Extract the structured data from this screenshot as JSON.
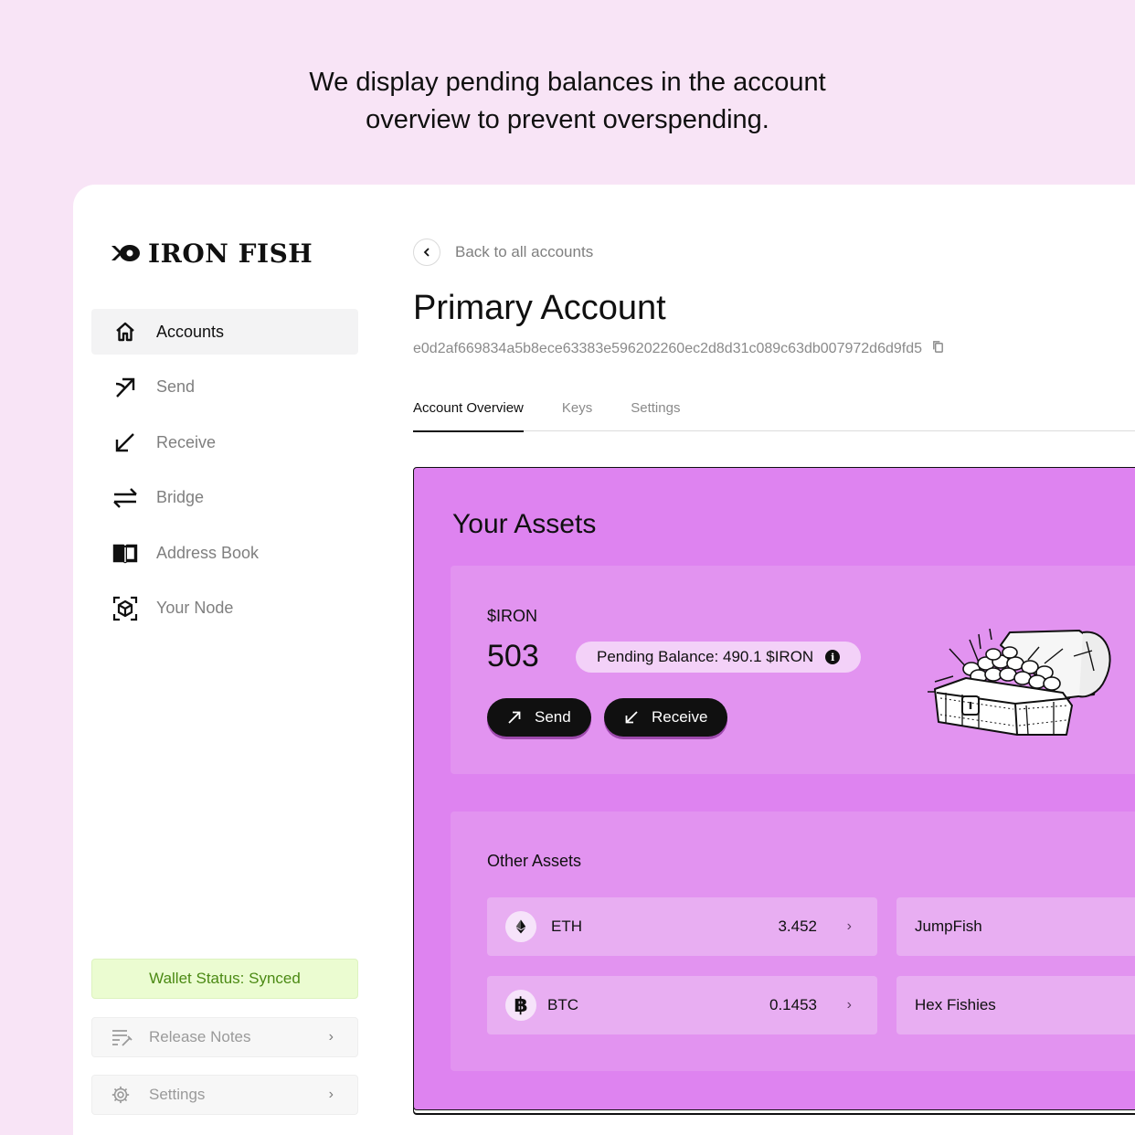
{
  "caption": {
    "line1": "We display pending balances in the account",
    "line2": "overview to prevent overspending."
  },
  "brand": {
    "name": "IRON FISH"
  },
  "sidebar": {
    "items": [
      {
        "label": "Accounts",
        "icon": "home-icon",
        "active": true
      },
      {
        "label": "Send",
        "icon": "send-arrow-icon"
      },
      {
        "label": "Receive",
        "icon": "receive-arrow-icon"
      },
      {
        "label": "Bridge",
        "icon": "bridge-arrows-icon"
      },
      {
        "label": "Address Book",
        "icon": "book-icon"
      },
      {
        "label": "Your Node",
        "icon": "node-cube-icon"
      }
    ],
    "wallet_status": "Wallet Status: Synced",
    "release_notes": "Release Notes",
    "settings": "Settings"
  },
  "main": {
    "back_label": "Back to all accounts",
    "title": "Primary Account",
    "address": "e0d2af669834a5b8ece63383e596202260ec2d8d31c089c63db007972d6d9fd5",
    "tabs": [
      {
        "label": "Account Overview",
        "active": true
      },
      {
        "label": "Keys"
      },
      {
        "label": "Settings"
      }
    ]
  },
  "assets": {
    "title": "Your Assets",
    "iron": {
      "label": "$IRON",
      "amount": "503",
      "pending": "Pending Balance: 490.1 $IRON",
      "send_label": "Send",
      "receive_label": "Receive"
    },
    "other_title": "Other Assets",
    "other": [
      {
        "name": "ETH",
        "value": "3.452",
        "icon": "ethereum-icon"
      },
      {
        "name": "JumpFish",
        "value": ""
      },
      {
        "name": "BTC",
        "value": "0.1453",
        "icon": "bitcoin-icon"
      },
      {
        "name": "Hex Fishies",
        "value": ""
      }
    ]
  },
  "colors": {
    "page_bg": "#F8E4F6",
    "assets_bg": "#DE83F0",
    "card_bg": "#E293F0",
    "status_bg": "#EBFCD1",
    "status_text": "#4B8A14"
  }
}
